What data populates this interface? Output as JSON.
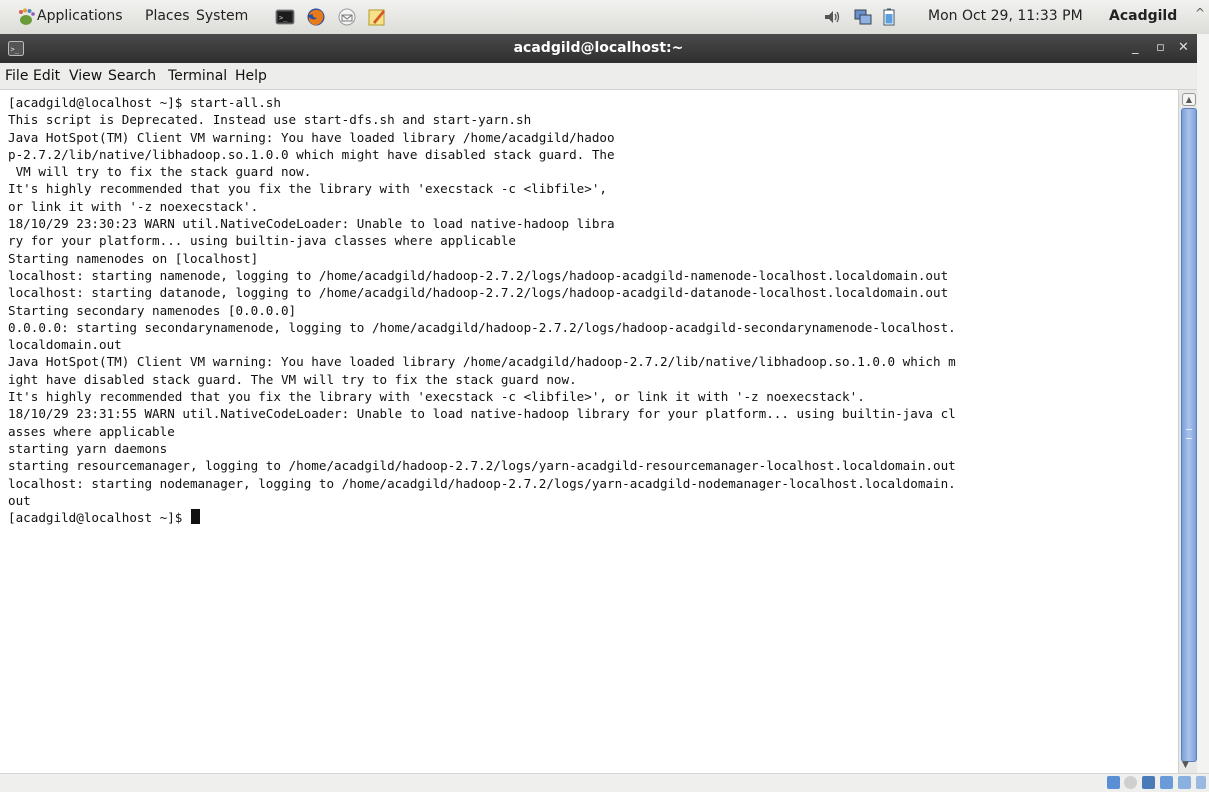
{
  "panel": {
    "menus": [
      "Applications",
      "Places",
      "System"
    ],
    "clock": "Mon Oct 29, 11:33 PM",
    "user": "Acadgild"
  },
  "window": {
    "title": "acadgild@localhost:~",
    "minimize": "_",
    "maximize": "▫",
    "close": "✕"
  },
  "menubar": [
    "File",
    "Edit",
    "View",
    "Search",
    "Terminal",
    "Help"
  ],
  "terminal": {
    "lines": [
      "[acadgild@localhost ~]$ start-all.sh",
      "This script is Deprecated. Instead use start-dfs.sh and start-yarn.sh",
      "Java HotSpot(TM) Client VM warning: You have loaded library /home/acadgild/hadoo",
      "p-2.7.2/lib/native/libhadoop.so.1.0.0 which might have disabled stack guard. The",
      " VM will try to fix the stack guard now.",
      "It's highly recommended that you fix the library with 'execstack -c <libfile>',",
      "or link it with '-z noexecstack'.",
      "18/10/29 23:30:23 WARN util.NativeCodeLoader: Unable to load native-hadoop libra",
      "ry for your platform... using builtin-java classes where applicable",
      "Starting namenodes on [localhost]",
      "localhost: starting namenode, logging to /home/acadgild/hadoop-2.7.2/logs/hadoop-acadgild-namenode-localhost.localdomain.out",
      "localhost: starting datanode, logging to /home/acadgild/hadoop-2.7.2/logs/hadoop-acadgild-datanode-localhost.localdomain.out",
      "Starting secondary namenodes [0.0.0.0]",
      "0.0.0.0: starting secondarynamenode, logging to /home/acadgild/hadoop-2.7.2/logs/hadoop-acadgild-secondarynamenode-localhost.",
      "localdomain.out",
      "Java HotSpot(TM) Client VM warning: You have loaded library /home/acadgild/hadoop-2.7.2/lib/native/libhadoop.so.1.0.0 which m",
      "ight have disabled stack guard. The VM will try to fix the stack guard now.",
      "It's highly recommended that you fix the library with 'execstack -c <libfile>', or link it with '-z noexecstack'.",
      "18/10/29 23:31:55 WARN util.NativeCodeLoader: Unable to load native-hadoop library for your platform... using builtin-java cl",
      "asses where applicable",
      "starting yarn daemons",
      "starting resourcemanager, logging to /home/acadgild/hadoop-2.7.2/logs/yarn-acadgild-resourcemanager-localhost.localdomain.out",
      "localhost: starting nodemanager, logging to /home/acadgild/hadoop-2.7.2/logs/yarn-acadgild-nodemanager-localhost.localdomain.",
      "out"
    ],
    "prompt": "[acadgild@localhost ~]$ "
  },
  "icons": {
    "applications": "gnome-foot-icon",
    "terminal": "terminal-icon",
    "browser": "firefox-icon",
    "mail": "mail-icon",
    "editor": "text-editor-icon",
    "volume": "volume-icon",
    "network": "network-icon",
    "battery": "battery-icon"
  },
  "colors": {
    "titlebar": "#3a3a3a",
    "scrollbar_thumb": "#8fb0e4",
    "panel": "#e8e8e6"
  }
}
